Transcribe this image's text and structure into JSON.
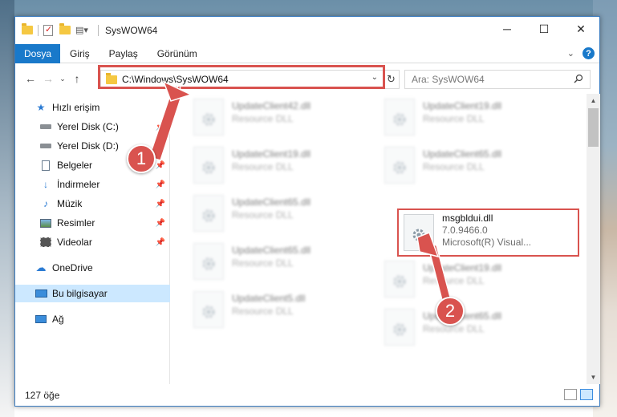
{
  "window": {
    "title": "SysWOW64"
  },
  "ribbon": {
    "tabs": [
      "Dosya",
      "Giriş",
      "Paylaş",
      "Görünüm"
    ]
  },
  "address": {
    "path": "C:\\Windows\\SysWOW64"
  },
  "search": {
    "placeholder": "Ara: SysWOW64"
  },
  "sidebar": {
    "items": [
      {
        "label": "Hızlı erişim",
        "icon": "star-icon"
      },
      {
        "label": "Yerel Disk (C:)",
        "icon": "drive-icon"
      },
      {
        "label": "Yerel Disk (D:)",
        "icon": "drive-icon"
      },
      {
        "label": "Belgeler",
        "icon": "documents-icon"
      },
      {
        "label": "İndirmeler",
        "icon": "downloads-icon"
      },
      {
        "label": "Müzik",
        "icon": "music-icon"
      },
      {
        "label": "Resimler",
        "icon": "pictures-icon"
      },
      {
        "label": "Videolar",
        "icon": "videos-icon"
      },
      {
        "label": "OneDrive",
        "icon": "cloud-icon"
      },
      {
        "label": "Bu bilgisayar",
        "icon": "computer-icon"
      },
      {
        "label": "Ağ",
        "icon": "network-icon"
      }
    ]
  },
  "files": {
    "items": [
      {
        "name": "UpdateClient42.dll",
        "sub": "Resource DLL",
        "sub2": ""
      },
      {
        "name": "UpdateClient19.dll",
        "sub": "Resource DLL",
        "sub2": ""
      },
      {
        "name": "UpdateClient19.dll",
        "sub": "Resource DLL",
        "sub2": ""
      },
      {
        "name": "UpdateClient65.dll",
        "sub": "Resource DLL",
        "sub2": ""
      },
      {
        "name": "UpdateClient65.dll",
        "sub": "Resource DLL",
        "sub2": ""
      },
      {
        "name": "msgbldui.dll",
        "sub": "7.0.9466.0",
        "sub2": "Microsoft(R) Visual..."
      },
      {
        "name": "UpdateClient65.dll",
        "sub": "Resource DLL",
        "sub2": ""
      },
      {
        "name": "UpdateClient19.dll",
        "sub": "Resource DLL",
        "sub2": ""
      },
      {
        "name": "UpdateClient5.dll",
        "sub": "Resource DLL",
        "sub2": ""
      },
      {
        "name": "UpdateClient65.dll",
        "sub": "Resource DLL",
        "sub2": ""
      }
    ]
  },
  "status": {
    "count": "127 öğe"
  },
  "callouts": {
    "one": "1",
    "two": "2"
  },
  "colors": {
    "accent": "#1979ca",
    "highlight": "#d9534f",
    "selected": "#cce8ff"
  }
}
